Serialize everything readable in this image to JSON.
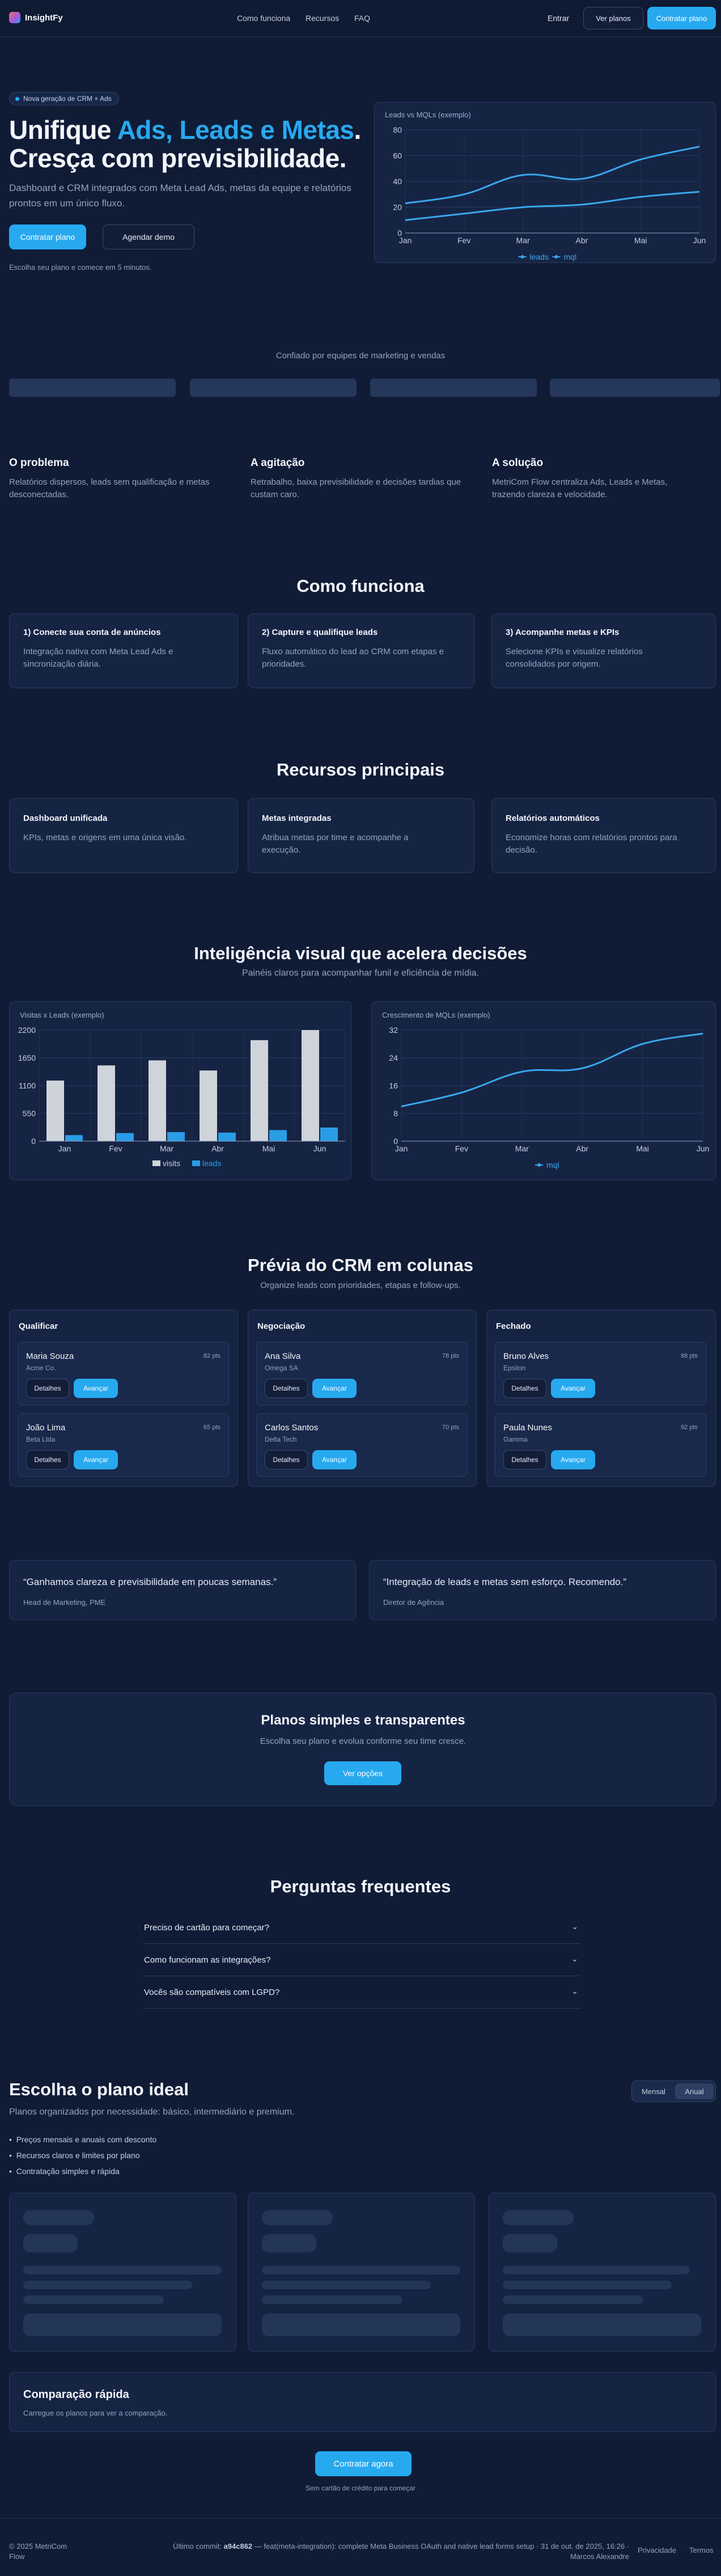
{
  "nav": {
    "brand": "InsightFy",
    "links": [
      "Como funciona",
      "Recursos",
      "FAQ"
    ],
    "enter": "Entrar",
    "see_plans": "Ver planos",
    "hire": "Contratar plano"
  },
  "hero": {
    "badge": "Nova geração de CRM + Ads",
    "title_part1": "Unifique ",
    "title_highlight": "Ads, Leads e Metas",
    "title_part2": ".",
    "title_line2": "Cresça com previsibilidade.",
    "description": "Dashboard e CRM integrados com Meta Lead Ads, metas da equipe e relatórios prontos em um único fluxo.",
    "primary_button": "Contratar plano",
    "secondary_button": "Agendar demo",
    "note": "Escolha seu plano e comece em 5 minutos."
  },
  "trusted": {
    "label": "Confiado por equipes de marketing e vendas"
  },
  "pas": [
    {
      "title": "O problema",
      "text": "Relatórios dispersos, leads sem qualificação e metas desconectadas."
    },
    {
      "title": "A agitação",
      "text": "Retrabalho, baixa previsibilidade e decisões tardias que custam caro."
    },
    {
      "title": "A solução",
      "text": "MetriCom Flow centraliza Ads, Leads e Metas, trazendo clareza e velocidade."
    }
  ],
  "how": {
    "title": "Como funciona",
    "steps": [
      {
        "title": "1) Conecte sua conta de anúncios",
        "text": "Integração nativa com Meta Lead Ads e sincronização diária."
      },
      {
        "title": "2) Capture e qualifique leads",
        "text": "Fluxo automático do lead ao CRM com etapas e prioridades."
      },
      {
        "title": "3) Acompanhe metas e KPIs",
        "text": "Selecione KPIs e visualize relatórios consolidados por origem."
      }
    ]
  },
  "features": {
    "title": "Recursos principais",
    "items": [
      {
        "title": "Dashboard unificada",
        "text": "KPIs, metas e origens em uma única visão."
      },
      {
        "title": "Metas integradas",
        "text": "Atribua metas por time e acompanhe a execução."
      },
      {
        "title": "Relatórios automáticos",
        "text": "Economize horas com relatórios prontos para decisão."
      }
    ]
  },
  "visual": {
    "title": "Inteligência visual que acelera decisões",
    "subtitle": "Painéis claros para acompanhar funil e eficiência de mídia."
  },
  "chart_data": [
    {
      "type": "line",
      "title": "Leads vs MQLs (exemplo)",
      "categories": [
        "Jan",
        "Fev",
        "Mar",
        "Abr",
        "Mai",
        "Jun"
      ],
      "ylim": [
        0,
        80
      ],
      "yticks": [
        0,
        20,
        40,
        60,
        80
      ],
      "series": [
        {
          "name": "leads",
          "values": [
            23,
            30,
            45,
            42,
            57,
            67
          ],
          "color": "#3aa7ee"
        },
        {
          "name": "mql",
          "values": [
            10,
            15,
            20,
            22,
            28,
            32
          ],
          "color": "#3aa7ee"
        }
      ],
      "legend": "bottom"
    },
    {
      "type": "bar",
      "title": "Visitas x Leads (exemplo)",
      "categories": [
        "Jan",
        "Fev",
        "Mar",
        "Abr",
        "Mai",
        "Jun"
      ],
      "ylim": [
        0,
        2200
      ],
      "yticks": [
        0,
        550,
        1100,
        1650,
        2200
      ],
      "ytick_labels": [
        "0",
        "550",
        "1100",
        "1650",
        "2200"
      ],
      "series": [
        {
          "name": "visits",
          "values": [
            1200,
            1500,
            1600,
            1400,
            2000,
            2200
          ],
          "color": "#cfd3da"
        },
        {
          "name": "leads",
          "values": [
            120,
            160,
            180,
            170,
            220,
            270
          ],
          "color": "#2a9de6"
        }
      ],
      "legend": "bottom"
    },
    {
      "type": "line",
      "title": "Crescimento de MQLs (exemplo)",
      "categories": [
        "Jan",
        "Fev",
        "Mar",
        "Abr",
        "Mai",
        "Jun"
      ],
      "ylim": [
        0,
        32
      ],
      "yticks": [
        0,
        8,
        16,
        24,
        32
      ],
      "series": [
        {
          "name": "mql",
          "values": [
            10,
            14,
            20,
            21,
            28,
            31
          ],
          "color": "#3aa7ee"
        }
      ],
      "legend": "bottom"
    }
  ],
  "crm": {
    "title": "Prévia do CRM em colunas",
    "subtitle": "Organize leads com prioridades, etapas e follow-ups.",
    "details_label": "Detalhes",
    "advance_label": "Avançar",
    "columns": [
      {
        "title": "Qualificar",
        "leads": [
          {
            "name": "Maria Souza",
            "company": "Acme Co.",
            "score": "82 pts"
          },
          {
            "name": "João Lima",
            "company": "Beta Ltda",
            "score": "65 pts"
          }
        ]
      },
      {
        "title": "Negociação",
        "leads": [
          {
            "name": "Ana Silva",
            "company": "Omega SA",
            "score": "78 pts"
          },
          {
            "name": "Carlos Santos",
            "company": "Delta Tech",
            "score": "70 pts"
          }
        ]
      },
      {
        "title": "Fechado",
        "leads": [
          {
            "name": "Bruno Alves",
            "company": "Epsilon",
            "score": "88 pts"
          },
          {
            "name": "Paula Nunes",
            "company": "Gamma",
            "score": "92 pts"
          }
        ]
      }
    ]
  },
  "testimonials": [
    {
      "quote": "“Ganhamos clareza e previsibilidade em poucas semanas.”",
      "author": "Head de Marketing, PME"
    },
    {
      "quote": "“Integração de leads e metas sem esforço. Recomendo.”",
      "author": "Diretor de Agência"
    }
  ],
  "plans_cta": {
    "title": "Planos simples e transparentes",
    "subtitle": "Escolha seu plano e evolua conforme seu time cresce.",
    "button": "Ver opções"
  },
  "faq": {
    "title": "Perguntas frequentes",
    "items": [
      "Preciso de cartão para começar?",
      "Como funcionam as integrações?",
      "Vocês são compatíveis com LGPD?"
    ]
  },
  "pricing": {
    "title": "Escolha o plano ideal",
    "subtitle": "Planos organizados por necessidade: básico, intermediário e premium.",
    "toggle": [
      "Mensal",
      "Anual"
    ],
    "bullets": [
      "Preços mensais e anuais com desconto",
      "Recursos claros e limites por plano",
      "Contratação simples e rápida"
    ]
  },
  "compare": {
    "title": "Comparação rápida",
    "text": "Carregue os planos para ver a comparação."
  },
  "final_cta": {
    "button": "Contratar agora",
    "note": "Sem cartão de crédito para começar"
  },
  "footer": {
    "copyright_line1": "© 2025 MetriCom",
    "copyright_line2": "Flow",
    "commit_prefix": "Último commit: ",
    "commit_hash": "a94c862",
    "commit_message": " — feat(meta-integration): complete Meta Business OAuth and native lead forms setup · 31 de out. de 2025, 16:26 ·",
    "commit_author": "Marcos Alexandre",
    "privacy": "Privacidade",
    "terms": "Termos"
  },
  "colors": {
    "background": "#101c36",
    "accent": "#27a9ef",
    "card": "#162444"
  }
}
